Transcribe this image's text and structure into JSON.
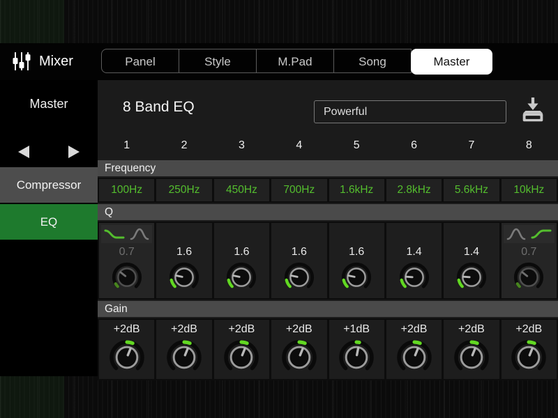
{
  "topbar": {
    "title": "Mixer",
    "tabs": [
      {
        "label": "Panel",
        "selected": false
      },
      {
        "label": "Style",
        "selected": false
      },
      {
        "label": "M.Pad",
        "selected": false
      },
      {
        "label": "Song",
        "selected": false
      },
      {
        "label": "Master",
        "selected": true
      }
    ]
  },
  "sidebar": {
    "target": "Master",
    "items": [
      {
        "label": "Compressor",
        "selected": false
      },
      {
        "label": "EQ",
        "selected": true
      }
    ]
  },
  "eq": {
    "title": "8 Band EQ",
    "preset": "Powerful",
    "section_labels": {
      "frequency": "Frequency",
      "q": "Q",
      "gain": "Gain"
    },
    "bands": [
      {
        "number": "1",
        "freq": "100Hz",
        "q": "0.7",
        "q_active": false,
        "filter_icons": [
          "low-shelf-green",
          "peak-gray"
        ],
        "gain": "+2dB"
      },
      {
        "number": "2",
        "freq": "250Hz",
        "q": "1.6",
        "q_active": true,
        "gain": "+2dB"
      },
      {
        "number": "3",
        "freq": "450Hz",
        "q": "1.6",
        "q_active": true,
        "gain": "+2dB"
      },
      {
        "number": "4",
        "freq": "700Hz",
        "q": "1.6",
        "q_active": true,
        "gain": "+2dB"
      },
      {
        "number": "5",
        "freq": "1.6kHz",
        "q": "1.6",
        "q_active": true,
        "gain": "+1dB"
      },
      {
        "number": "6",
        "freq": "2.8kHz",
        "q": "1.4",
        "q_active": true,
        "gain": "+2dB"
      },
      {
        "number": "7",
        "freq": "5.6kHz",
        "q": "1.4",
        "q_active": true,
        "gain": "+2dB"
      },
      {
        "number": "8",
        "freq": "10kHz",
        "q": "0.7",
        "q_active": false,
        "filter_icons": [
          "peak-gray",
          "high-shelf-green"
        ],
        "gain": "+2dB"
      }
    ],
    "colors": {
      "accent_green": "#54be2e",
      "selected_green_bg": "#1e7a2d",
      "knob_green": "#62d822",
      "header_gray": "#4a4a4a"
    }
  }
}
